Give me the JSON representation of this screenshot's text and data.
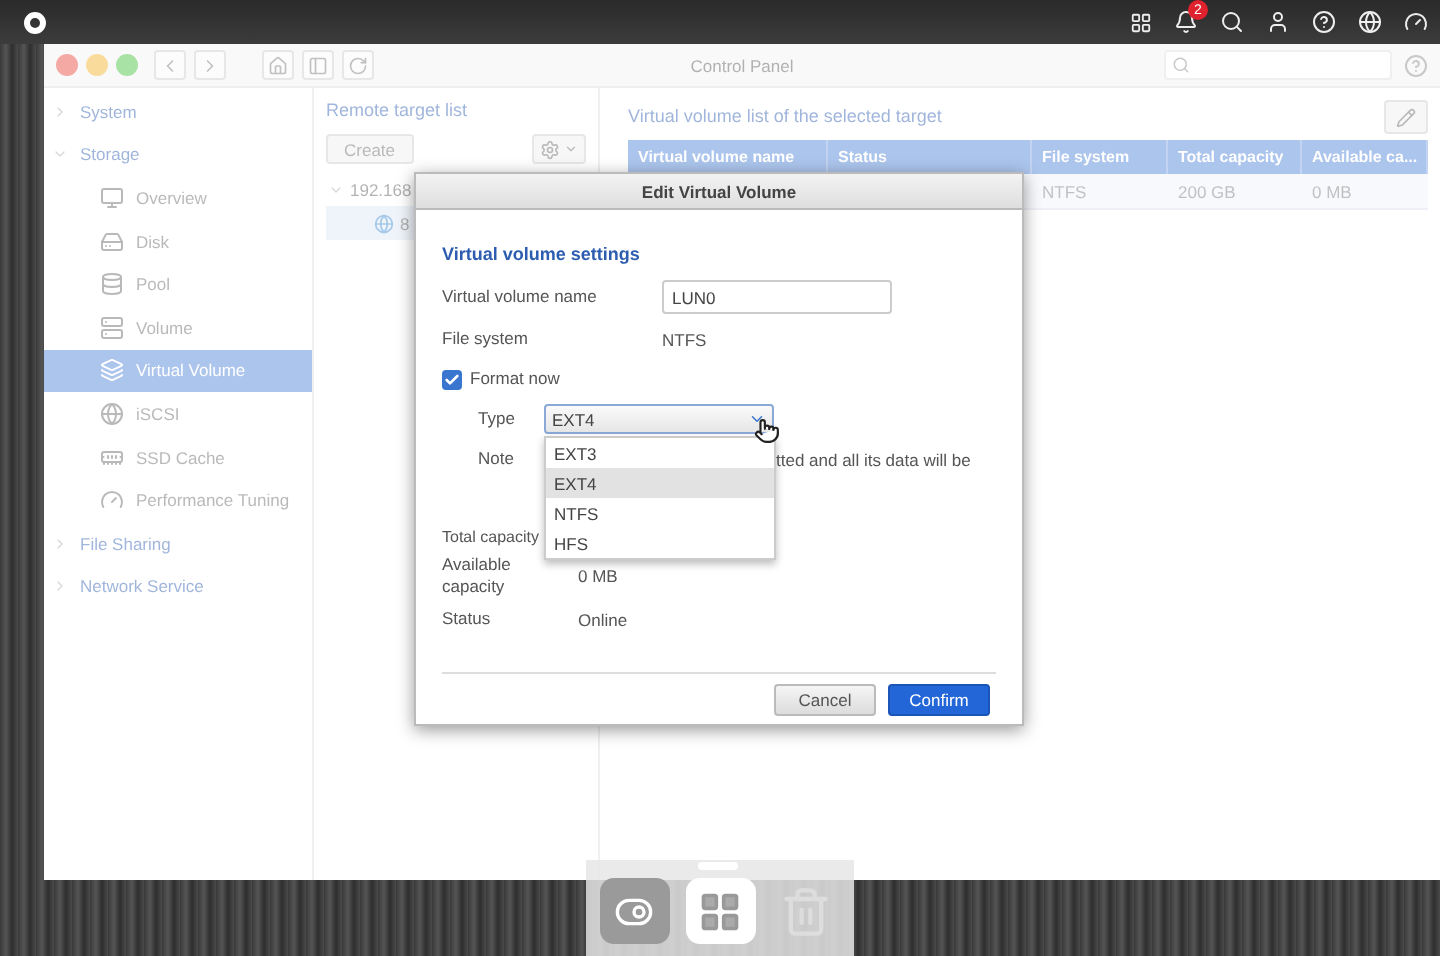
{
  "top_bar": {
    "notification_count": "2"
  },
  "window": {
    "title": "Control Panel"
  },
  "sidebar": {
    "items": [
      {
        "label": "System",
        "expanded": false
      },
      {
        "label": "Storage",
        "expanded": true,
        "children": [
          {
            "label": "Overview",
            "selected": false
          },
          {
            "label": "Disk",
            "selected": false
          },
          {
            "label": "Pool",
            "selected": false
          },
          {
            "label": "Volume",
            "selected": false
          },
          {
            "label": "Virtual Volume",
            "selected": true
          },
          {
            "label": "iSCSI",
            "selected": false
          },
          {
            "label": "SSD Cache",
            "selected": false
          },
          {
            "label": "Performance Tuning",
            "selected": false
          }
        ]
      },
      {
        "label": "File Sharing",
        "expanded": false
      },
      {
        "label": "Network Service",
        "expanded": false
      }
    ]
  },
  "remote_targets": {
    "title": "Remote target list",
    "create_button": "Create",
    "tree": [
      {
        "label": "192.168",
        "expanded": true,
        "children": [
          {
            "label": "8",
            "selected": true
          }
        ]
      }
    ]
  },
  "volume_list": {
    "title": "Virtual volume list of the selected target",
    "columns": [
      "Virtual volume name",
      "Status",
      "File system",
      "Total capacity",
      "Available ca..."
    ],
    "rows": [
      {
        "file_system": "NTFS",
        "total_capacity": "200 GB",
        "available_capacity": "0 MB"
      }
    ]
  },
  "dialog": {
    "title": "Edit Virtual Volume",
    "section": "Virtual volume settings",
    "name_field": {
      "label": "Virtual volume name",
      "value": "LUN0"
    },
    "file_system": {
      "label": "File system",
      "value": "NTFS"
    },
    "format_now": {
      "label": "Format now",
      "checked": true
    },
    "type": {
      "label": "Type",
      "value": "EXT4",
      "expanded": true,
      "options": [
        {
          "label": "EXT3",
          "selected": false
        },
        {
          "label": "EXT4",
          "selected": true
        },
        {
          "label": "NTFS",
          "selected": false
        },
        {
          "label": "HFS",
          "selected": false
        }
      ]
    },
    "note": {
      "label": "Note",
      "text": "tted and all its data will be"
    },
    "total_capacity": {
      "label": "Total capacity"
    },
    "available_capacity": {
      "label": "Available capacity",
      "value": "0 MB"
    },
    "status": {
      "label": "Status",
      "value": "Online"
    },
    "buttons": [
      {
        "label": "Cancel",
        "kind": "secondary"
      },
      {
        "label": "Confirm",
        "kind": "primary"
      }
    ]
  }
}
